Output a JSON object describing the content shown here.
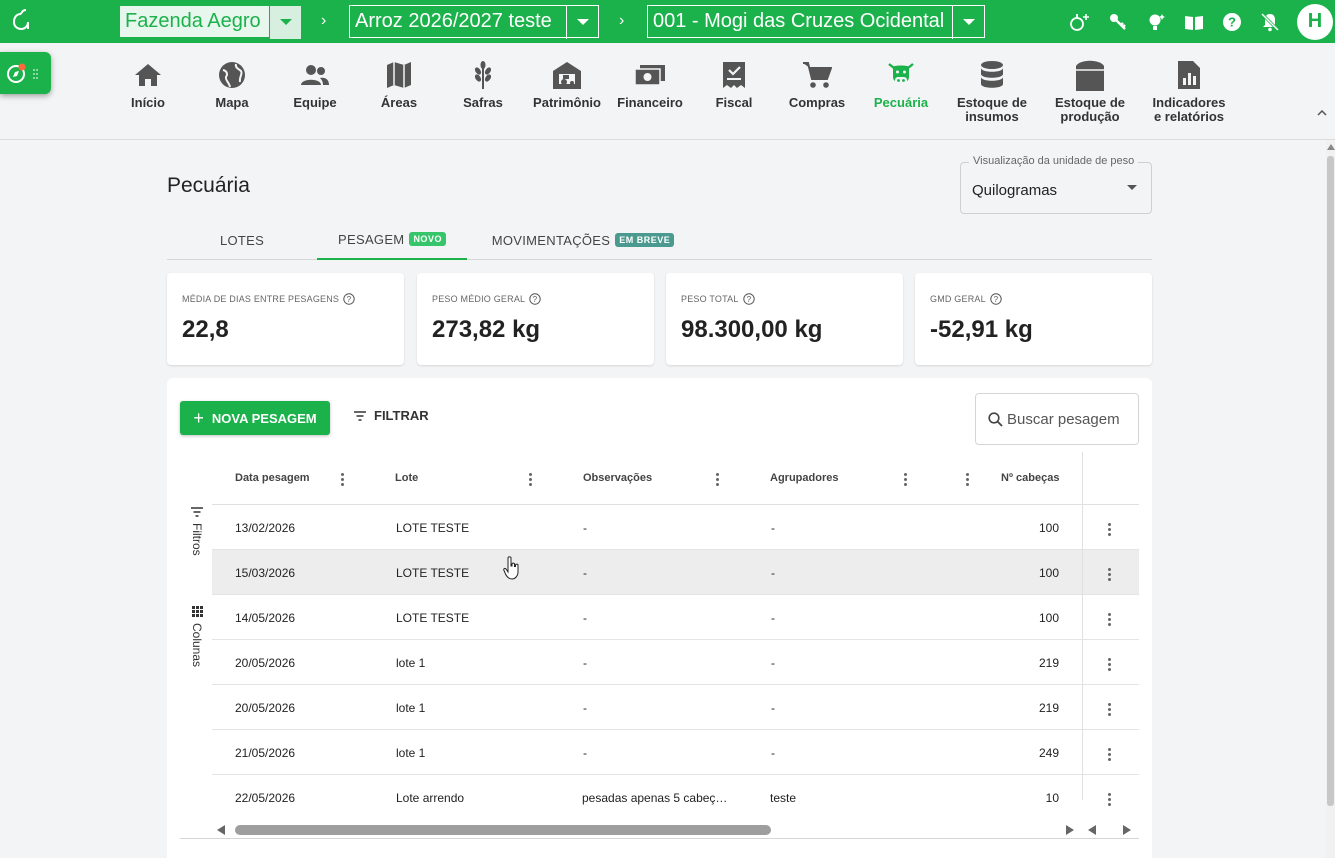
{
  "topbar": {
    "farm": "Fazenda Aegro",
    "season": "Arroz 2026/2027 teste",
    "property": "001 - Mogi das Cruzes Ocidental",
    "crumb_sep": "›",
    "avatar_initial": "H",
    "icons": [
      "add-user-icon",
      "key-icon",
      "lightbulb-icon",
      "book-icon",
      "help-icon",
      "notifications-off-icon"
    ]
  },
  "nav": {
    "items": [
      {
        "label": "Início",
        "icon": "home-icon"
      },
      {
        "label": "Mapa",
        "icon": "globe-icon"
      },
      {
        "label": "Equipe",
        "icon": "team-icon"
      },
      {
        "label": "Áreas",
        "icon": "map-icon"
      },
      {
        "label": "Safras",
        "icon": "wheat-icon"
      },
      {
        "label": "Patrimônio",
        "icon": "tractor-icon"
      },
      {
        "label": "Financeiro",
        "icon": "money-icon"
      },
      {
        "label": "Fiscal",
        "icon": "receipt-icon"
      },
      {
        "label": "Compras",
        "icon": "cart-icon"
      },
      {
        "label": "Pecuária",
        "icon": "cow-icon",
        "active": true
      },
      {
        "label": "Estoque de\ninsumos",
        "icon": "database-icon"
      },
      {
        "label": "Estoque de\nprodução",
        "icon": "silo-icon"
      },
      {
        "label": "Indicadores\ne relatórios",
        "icon": "report-icon"
      }
    ]
  },
  "page": {
    "title": "Pecuária",
    "unit_label": "Visualização da unidade de peso",
    "unit_value": "Quilogramas"
  },
  "tabs": [
    {
      "label": "LOTES",
      "badge": ""
    },
    {
      "label": "PESAGEM",
      "badge": "NOVO"
    },
    {
      "label": "MOVIMENTAÇÕES",
      "badge": "EM BREVE"
    }
  ],
  "cards": [
    {
      "title": "MÉDIA DE DIAS ENTRE PESAGENS",
      "value": "22,8"
    },
    {
      "title": "PESO MÉDIO GERAL",
      "value": "273,82 kg"
    },
    {
      "title": "PESO TOTAL",
      "value": "98.300,00 kg"
    },
    {
      "title": "GMD GERAL",
      "value": "-52,91 kg"
    }
  ],
  "toolbar": {
    "new_label": "NOVA PESAGEM",
    "filter_label": "FILTRAR",
    "search_placeholder": "Buscar pesagem"
  },
  "side_tools": {
    "filters": "Filtros",
    "columns": "Colunas"
  },
  "table": {
    "columns": [
      "Data pesagem",
      "Lote",
      "Observações",
      "Agrupadores",
      "Nº cabeças"
    ],
    "rows": [
      {
        "date": "13/02/2026",
        "lot": "LOTE TESTE",
        "notes": "-",
        "groups": "-",
        "heads": "100"
      },
      {
        "date": "15/03/2026",
        "lot": "LOTE TESTE",
        "notes": "-",
        "groups": "-",
        "heads": "100"
      },
      {
        "date": "14/05/2026",
        "lot": "LOTE TESTE",
        "notes": "-",
        "groups": "-",
        "heads": "100"
      },
      {
        "date": "20/05/2026",
        "lot": "lote 1",
        "notes": "-",
        "groups": "-",
        "heads": "219"
      },
      {
        "date": "20/05/2026",
        "lot": "lote 1",
        "notes": "-",
        "groups": "-",
        "heads": "219"
      },
      {
        "date": "21/05/2026",
        "lot": "lote 1",
        "notes": "-",
        "groups": "-",
        "heads": "249"
      },
      {
        "date": "22/05/2026",
        "lot": "Lote arrendo",
        "notes": "pesadas apenas 5 cabeç…",
        "groups": "teste",
        "heads": "10"
      }
    ]
  },
  "colors": {
    "brand": "#1bb24b",
    "badge_new": "#36c56a",
    "badge_soon": "#4a9a8f"
  }
}
